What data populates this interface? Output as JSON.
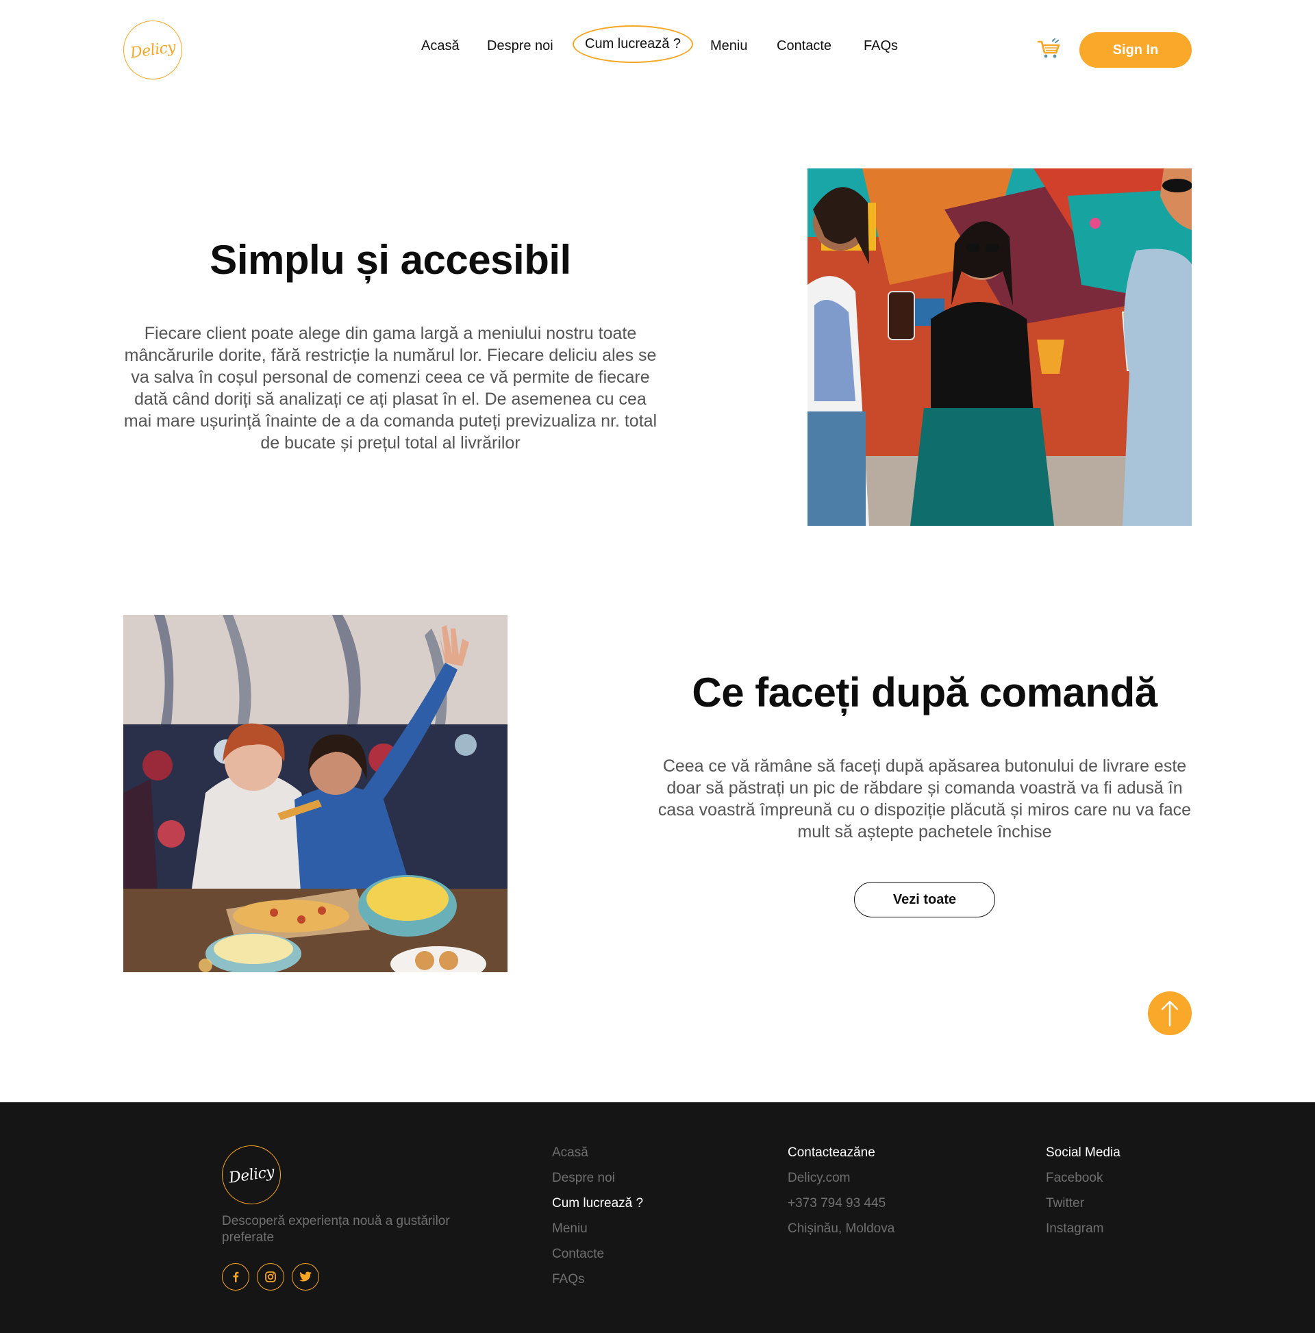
{
  "brand": {
    "logo_text": "Delicy",
    "accent_color": "#f9a82a"
  },
  "nav": {
    "items": [
      {
        "label": "Acasă"
      },
      {
        "label": "Despre noi"
      },
      {
        "label": "Cum lucrează ?"
      },
      {
        "label": "Meniu"
      },
      {
        "label": "Contacte"
      },
      {
        "label": "FAQs"
      }
    ],
    "active": "Cum lucrează ?",
    "cart_icon": "shopping-cart-icon",
    "signin_label": "Sign In"
  },
  "section1": {
    "title": "Simplu și accesibil",
    "body": "Fiecare client poate alege din gama largă a meniului nostru toate mâncărurile dorite, fără restricție la numărul lor. Fiecare deliciu ales se va salva în coșul personal de comenzi ceea ce vă permite de fiecare dată când doriți să analizați ce ați plasat în el. De asemenea cu cea mai mare ușurință înainte de a da comanda puteți previzualiza nr. total de bucate și prețul total al livrărilor"
  },
  "section2": {
    "title": "Ce faceți după comandă",
    "body": "Ceea ce vă rămâne să faceți după apăsarea butonului de livrare este doar să păstrați un pic de răbdare și comanda voastră va fi adusă în casa voastră împreună cu o dispoziție plăcută și miros care nu va face mult să aștepte pachetele închise",
    "button_label": "Vezi toate"
  },
  "scroll_top_icon": "arrow-up-icon",
  "footer": {
    "logo_text": "Delicy",
    "tagline": "Descoperă experiența nouă a gustărilor preferate",
    "social_icons": [
      "facebook-icon",
      "instagram-icon",
      "twitter-icon"
    ],
    "nav_links": [
      "Acasă",
      "Despre noi",
      "Cum  lucrează ?",
      "Meniu",
      "Contacte",
      "FAQs"
    ],
    "contact": {
      "heading": "Contacteazăne",
      "lines": [
        "Delicy.com",
        "+373 794 93 445",
        "Chișinău, Moldova"
      ]
    },
    "social": {
      "heading": "Social Media",
      "links": [
        "Facebook",
        "Twitter",
        "Instagram"
      ]
    }
  }
}
